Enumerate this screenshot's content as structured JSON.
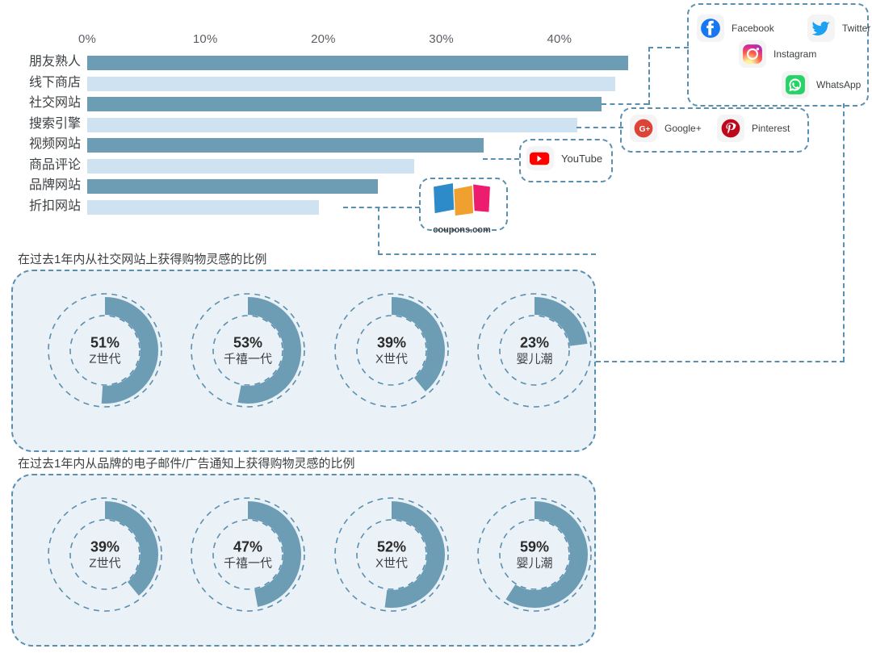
{
  "chart_data": [
    {
      "type": "bar",
      "orientation": "horizontal",
      "title": "",
      "xlabel": "",
      "ylabel": "",
      "xlim": [
        0,
        47
      ],
      "grid": false,
      "tick_labels": [
        "0%",
        "10%",
        "20%",
        "30%",
        "40%"
      ],
      "ticks": [
        0,
        10,
        20,
        30,
        40
      ],
      "categories": [
        "朋友熟人",
        "线下商店",
        "社交网站",
        "搜索引擎",
        "视频网站",
        "商品评论",
        "品牌网站",
        "折扣网站"
      ],
      "values": [
        45.8,
        44.7,
        43.6,
        41.5,
        33.6,
        27.7,
        24.6,
        19.6
      ]
    },
    {
      "type": "pie",
      "subtype": "donut",
      "title": "在过去1年内从社交网站上获得购物灵感的比例",
      "categories": [
        "Z世代",
        "千禧一代",
        "X世代",
        "婴儿潮"
      ],
      "values": [
        51,
        53,
        39,
        23
      ],
      "labels": [
        "51%",
        "53%",
        "39%",
        "23%"
      ]
    },
    {
      "type": "pie",
      "subtype": "donut",
      "title": "在过去1年内从品牌的电子邮件/广告通知上获得购物灵感的比例",
      "categories": [
        "Z世代",
        "千禧一代",
        "X世代",
        "婴儿潮"
      ],
      "values": [
        39,
        47,
        52,
        59
      ],
      "labels": [
        "39%",
        "47%",
        "52%",
        "59%"
      ]
    }
  ],
  "colors": {
    "bar_dark": "#6d9cb5",
    "bar_light": "#cfe2f1",
    "dash": "#5b8fb0",
    "panel_fill": "#eaf2f7",
    "donut_arc": "#6d9cb5"
  },
  "bar_chart": {
    "axis": [
      {
        "label": "0%",
        "value": 0
      },
      {
        "label": "10%",
        "value": 10
      },
      {
        "label": "20%",
        "value": 20
      },
      {
        "label": "30%",
        "value": 30
      },
      {
        "label": "40%",
        "value": 40
      }
    ],
    "rows": [
      {
        "label": "朋友熟人",
        "value": 45.8,
        "tone": "dark"
      },
      {
        "label": "线下商店",
        "value": 44.7,
        "tone": "light"
      },
      {
        "label": "社交网站",
        "value": 43.6,
        "tone": "dark"
      },
      {
        "label": "搜索引擎",
        "value": 41.5,
        "tone": "light"
      },
      {
        "label": "视频网站",
        "value": 33.6,
        "tone": "dark"
      },
      {
        "label": "商品评论",
        "value": 27.7,
        "tone": "light"
      },
      {
        "label": "品牌网站",
        "value": 24.6,
        "tone": "dark"
      },
      {
        "label": "折扣网站",
        "value": 19.6,
        "tone": "light"
      }
    ]
  },
  "social_box": {
    "items": [
      {
        "name": "Facebook",
        "icon": "facebook-icon"
      },
      {
        "name": "Twitter",
        "icon": "twitter-icon"
      },
      {
        "name": "Instagram",
        "icon": "instagram-icon"
      },
      {
        "name": "WhatsApp",
        "icon": "whatsapp-icon"
      }
    ]
  },
  "search_box": {
    "items": [
      {
        "name": "Google+",
        "icon": "google-plus-icon"
      },
      {
        "name": "Pinterest",
        "icon": "pinterest-icon"
      }
    ]
  },
  "video_box": {
    "items": [
      {
        "name": "YouTube",
        "icon": "youtube-icon"
      }
    ]
  },
  "discount_box": {
    "items": [
      {
        "name": "coupons.com",
        "icon": "coupons-icon"
      }
    ]
  },
  "panels": [
    {
      "title": "在过去1年内从社交网站上获得购物灵感的比例",
      "donuts": [
        {
          "pct": "51%",
          "value": 51,
          "generation": "Z世代"
        },
        {
          "pct": "53%",
          "value": 53,
          "generation": "千禧一代"
        },
        {
          "pct": "39%",
          "value": 39,
          "generation": "X世代"
        },
        {
          "pct": "23%",
          "value": 23,
          "generation": "婴儿潮"
        }
      ]
    },
    {
      "title": "在过去1年内从品牌的电子邮件/广告通知上获得购物灵感的比例",
      "donuts": [
        {
          "pct": "39%",
          "value": 39,
          "generation": "Z世代"
        },
        {
          "pct": "47%",
          "value": 47,
          "generation": "千禧一代"
        },
        {
          "pct": "52%",
          "value": 52,
          "generation": "X世代"
        },
        {
          "pct": "59%",
          "value": 59,
          "generation": "婴儿潮"
        }
      ]
    }
  ]
}
